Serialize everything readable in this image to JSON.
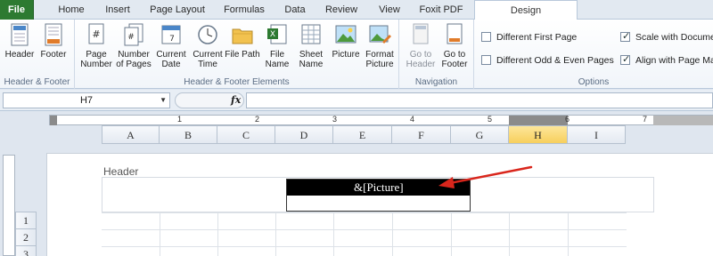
{
  "tabs": [
    "File",
    "Home",
    "Insert",
    "Page Layout",
    "Formulas",
    "Data",
    "Review",
    "View",
    "Foxit PDF",
    "Design"
  ],
  "active_tab": "Design",
  "ribbon": {
    "group1": {
      "label": "Header & Footer",
      "buttons": [
        "Header",
        "Footer"
      ]
    },
    "group2": {
      "label": "Header & Footer Elements",
      "buttons": [
        "Page Number",
        "Number of Pages",
        "Current Date",
        "Current Time",
        "File Path",
        "File Name",
        "Sheet Name",
        "Picture",
        "Format Picture"
      ]
    },
    "group3": {
      "label": "Navigation",
      "buttons": [
        "Go to Header",
        "Go to Footer"
      ]
    },
    "group4": {
      "label": "Options",
      "checkboxes": [
        {
          "label": "Different First Page",
          "checked": false
        },
        {
          "label": "Different Odd & Even Pages",
          "checked": false
        },
        {
          "label": "Scale with Document",
          "checked": true
        },
        {
          "label": "Align with Page Margins",
          "checked": true
        }
      ]
    }
  },
  "formula_bar": {
    "name_box": "H7",
    "fx": "fx",
    "value": ""
  },
  "ruler_numbers": [
    "1",
    "2",
    "3",
    "4",
    "5",
    "6",
    "7"
  ],
  "columns": [
    "A",
    "B",
    "C",
    "D",
    "E",
    "F",
    "G",
    "H",
    "I"
  ],
  "selected_column": "H",
  "rows": [
    "1",
    "2",
    "3"
  ],
  "page": {
    "header_label": "Header",
    "header_field": "&[Picture]"
  },
  "colors": {
    "file_tab": "#2d7a31",
    "selected_column": "#f7cf5c",
    "arrow": "#d9261c"
  }
}
